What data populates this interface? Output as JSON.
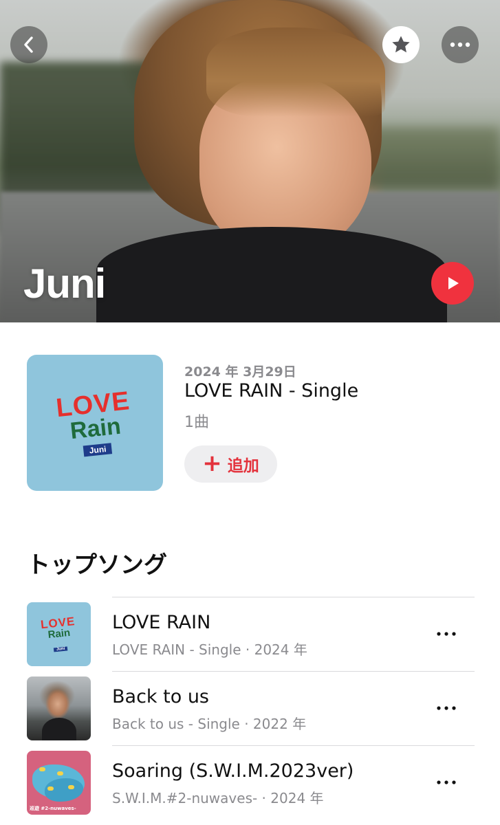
{
  "artist": {
    "name": "Juni"
  },
  "header_icons": {
    "back": "chevron-left-icon",
    "favorite": "star-icon",
    "more": "ellipsis-icon",
    "play": "play-icon"
  },
  "colors": {
    "accent": "#f0323e",
    "secondary_text": "#8a8a8e",
    "add_button_bg": "#eeeef0"
  },
  "latest_release": {
    "date": "2024 年 3月29日",
    "title": "LOVE RAIN - Single",
    "track_count": "1曲",
    "add_label": "追加",
    "add_symbol": "+",
    "artwork": {
      "love": "LOVE",
      "rain": "Rain",
      "artist": "Juni"
    }
  },
  "top_songs": {
    "heading": "トップソング",
    "items": [
      {
        "title": "LOVE RAIN",
        "subtitle": "LOVE RAIN - Single · 2024 年",
        "artwork": {
          "love": "LOVE",
          "rain": "Rain",
          "artist": "Juni"
        }
      },
      {
        "title": "Back to us",
        "subtitle": "Back to us - Single · 2022 年"
      },
      {
        "title": "Soaring (S.W.I.M.2023ver)",
        "subtitle": "S.W.I.M.#2-nuwaves- · 2024 年",
        "artwork": {
          "caption": "巡遊 #2-nuwaves-"
        }
      }
    ]
  }
}
